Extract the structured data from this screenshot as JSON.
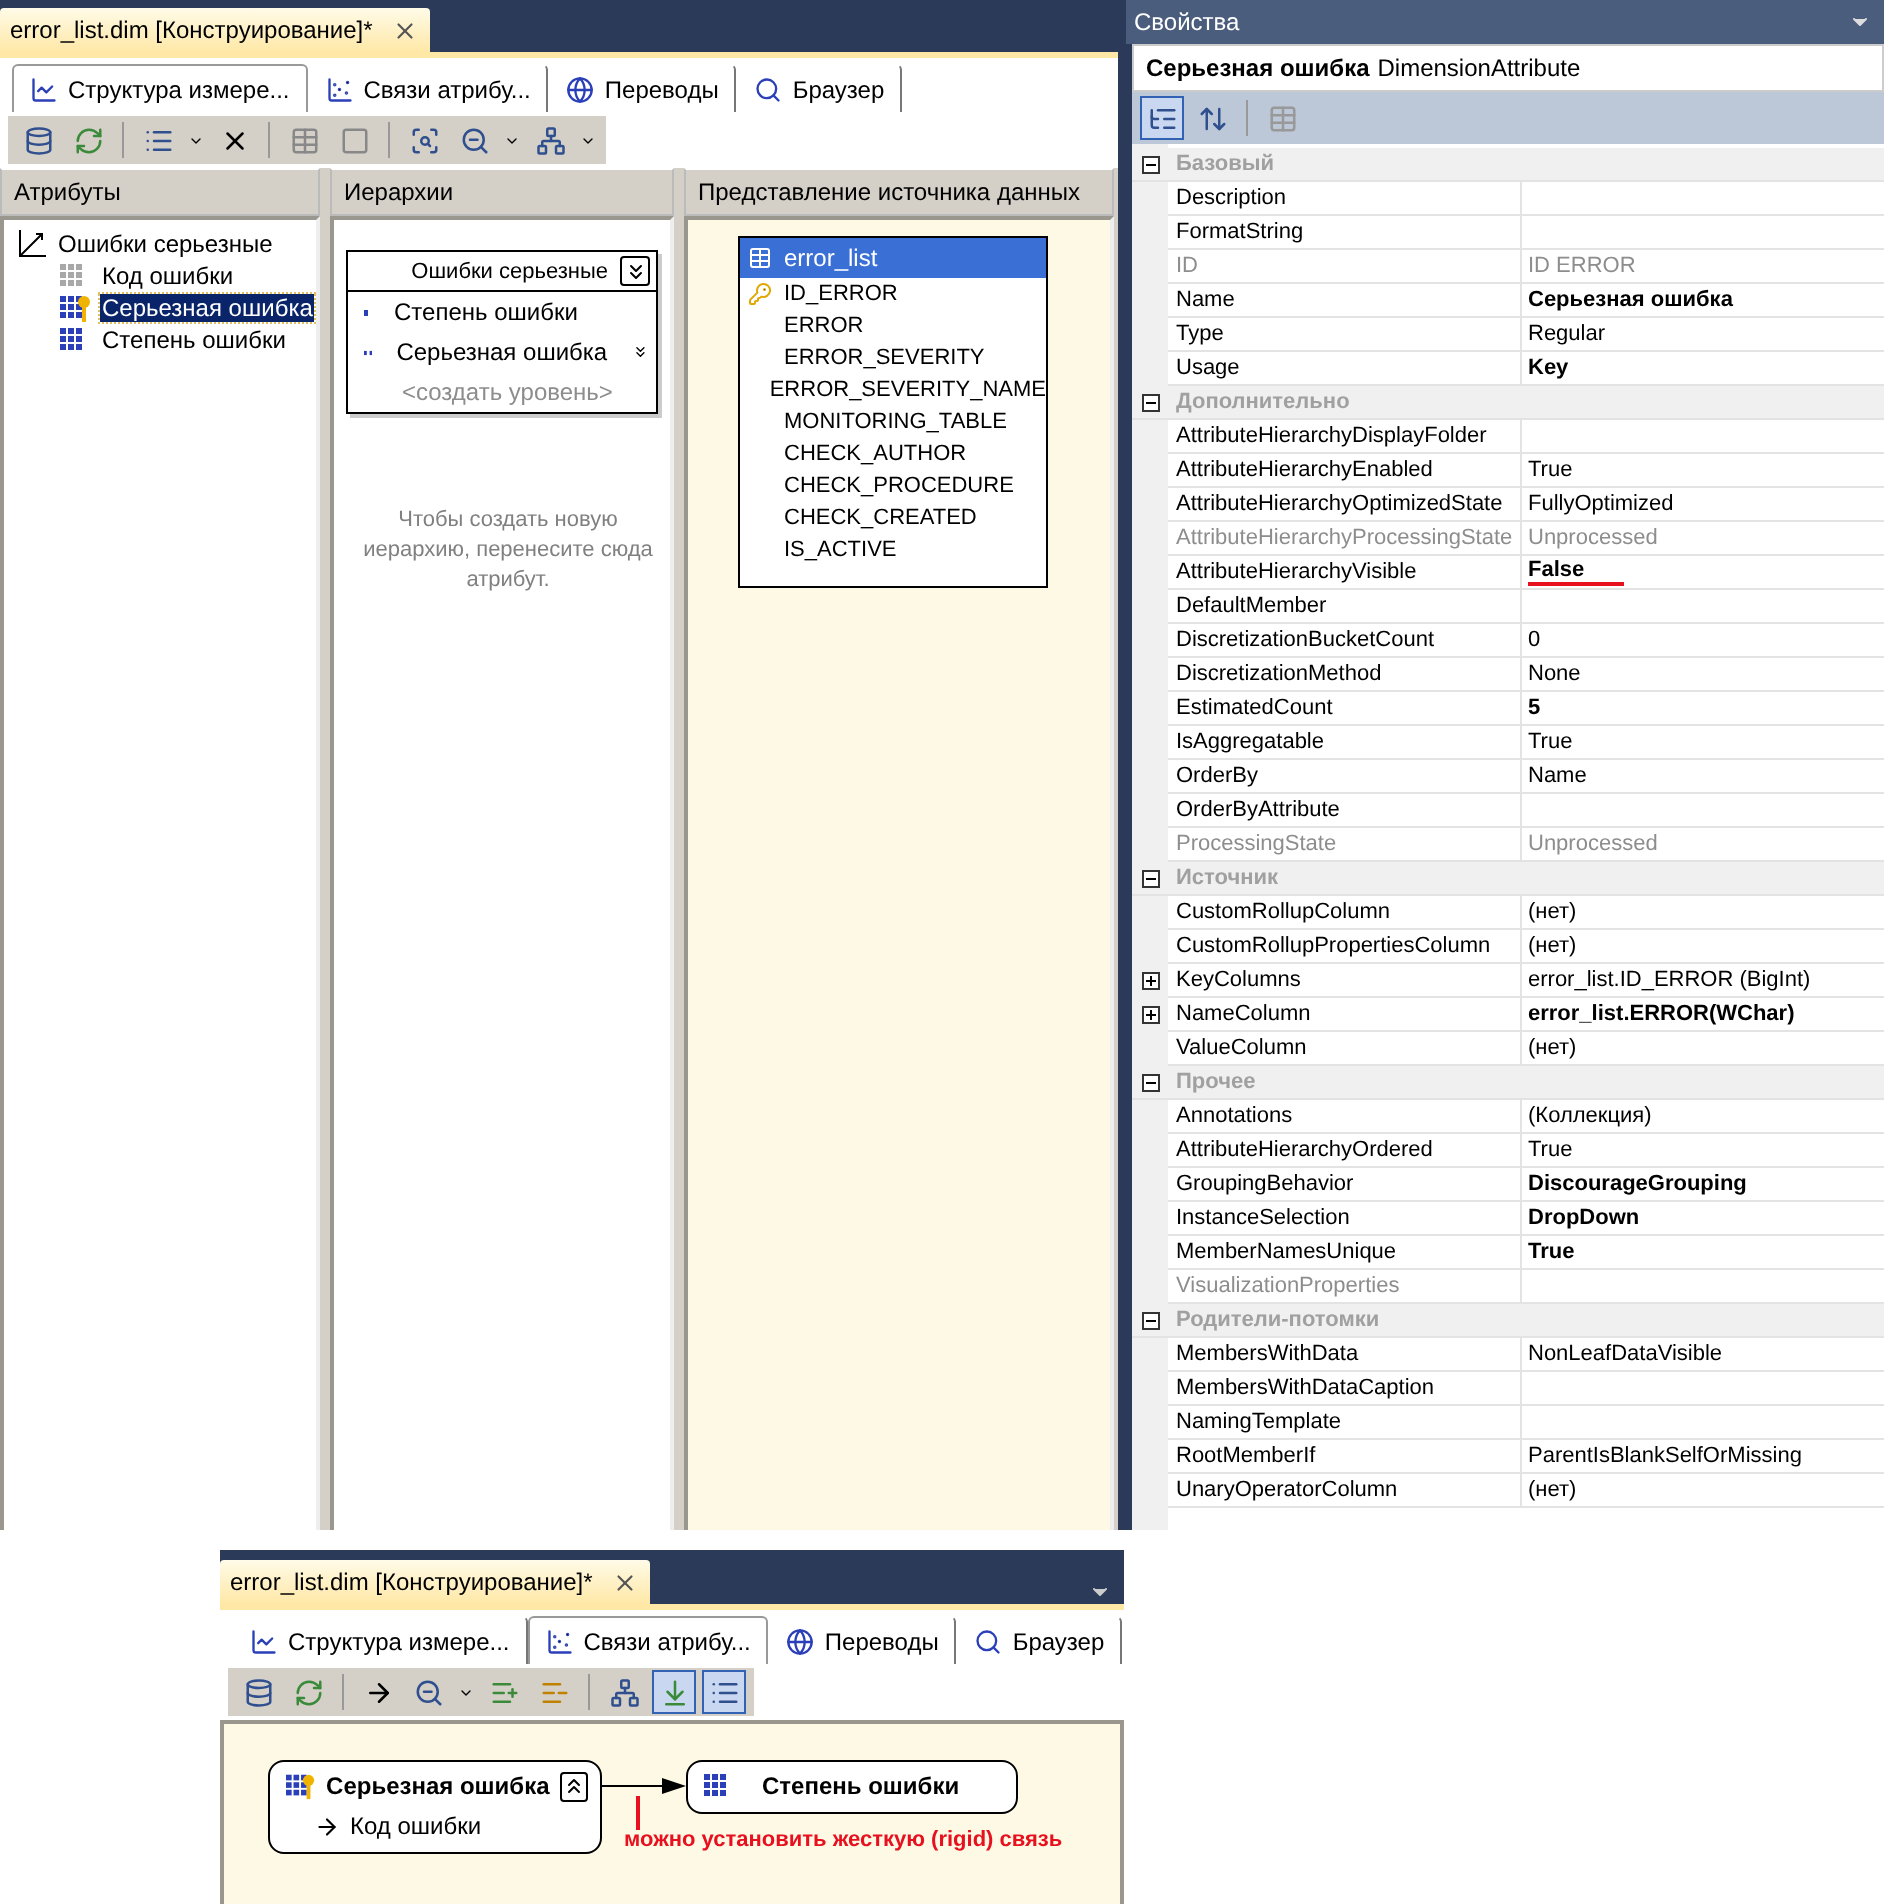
{
  "main_window": {
    "document_tab": {
      "title": "error_list.dim [Конструирование]*"
    },
    "designer_tabs": [
      {
        "label": "Структура измере...",
        "selected": true
      },
      {
        "label": "Связи атрибу...",
        "selected": false
      },
      {
        "label": "Переводы",
        "selected": false
      },
      {
        "label": "Браузер",
        "selected": false
      }
    ],
    "attributes_pane": {
      "title": "Атрибуты",
      "dimension": "Ошибки серьезные",
      "items": [
        {
          "label": "Код ошибки",
          "kind": "inactive",
          "selected": false
        },
        {
          "label": "Серьезная ошибка",
          "kind": "key",
          "selected": true
        },
        {
          "label": "Степень ошибки",
          "kind": "attribute",
          "selected": false
        }
      ]
    },
    "hierarchies_pane": {
      "title": "Иерархии",
      "hierarchy": {
        "name": "Ошибки серьезные",
        "levels": [
          "Степень ошибки",
          "Серьезная ошибка"
        ],
        "placeholder": "<создать уровень>"
      },
      "hint": "Чтобы создать новую иерархию, перенесите сюда атрибут."
    },
    "dsv_pane": {
      "title": "Представление источника данных",
      "table": {
        "name": "error_list",
        "columns": [
          {
            "name": "ID_ERROR",
            "key": true
          },
          {
            "name": "ERROR",
            "key": false
          },
          {
            "name": "ERROR_SEVERITY",
            "key": false
          },
          {
            "name": "ERROR_SEVERITY_NAME",
            "key": false
          },
          {
            "name": "MONITORING_TABLE",
            "key": false
          },
          {
            "name": "CHECK_AUTHOR",
            "key": false
          },
          {
            "name": "CHECK_PROCEDURE",
            "key": false
          },
          {
            "name": "CHECK_CREATED",
            "key": false
          },
          {
            "name": "IS_ACTIVE",
            "key": false
          }
        ]
      }
    }
  },
  "properties": {
    "title": "Свойства",
    "object_name": "Серьезная ошибка",
    "object_type": "DimensionAttribute",
    "categories": [
      {
        "name": "Базовый",
        "expanded": true,
        "rows": [
          {
            "name": "Description",
            "disabled": false
          },
          {
            "name": "FormatString",
            "disabled": false
          },
          {
            "name": "ID",
            "value": "ID ERROR",
            "disabled": true
          },
          {
            "name": "Name",
            "value": "Серьезная ошибка",
            "bold": true,
            "disabled": false
          },
          {
            "name": "Type",
            "value": "Regular",
            "disabled": false
          },
          {
            "name": "Usage",
            "value": "Key",
            "bold": true,
            "disabled": false
          }
        ]
      },
      {
        "name": "Дополнительно",
        "expanded": true,
        "rows": [
          {
            "name": "AttributeHierarchyDisplayFolder",
            "disabled": false
          },
          {
            "name": "AttributeHierarchyEnabled",
            "value": "True",
            "disabled": false
          },
          {
            "name": "AttributeHierarchyOptimizedState",
            "value": "FullyOptimized",
            "disabled": false
          },
          {
            "name": "AttributeHierarchyProcessingState",
            "value": "Unprocessed",
            "disabled": true
          },
          {
            "name": "AttributeHierarchyVisible",
            "value": "False",
            "bold": true,
            "disabled": false,
            "underlined": true
          },
          {
            "name": "DefaultMember",
            "disabled": false
          },
          {
            "name": "DiscretizationBucketCount",
            "value": "0",
            "disabled": false
          },
          {
            "name": "DiscretizationMethod",
            "value": "None",
            "disabled": false
          },
          {
            "name": "EstimatedCount",
            "value": "5",
            "bold": true,
            "disabled": false
          },
          {
            "name": "IsAggregatable",
            "value": "True",
            "disabled": false
          },
          {
            "name": "OrderBy",
            "value": "Name",
            "disabled": false
          },
          {
            "name": "OrderByAttribute",
            "disabled": false
          },
          {
            "name": "ProcessingState",
            "value": "Unprocessed",
            "disabled": true
          }
        ]
      },
      {
        "name": "Источник",
        "expanded": true,
        "rows": [
          {
            "name": "CustomRollupColumn",
            "value": "(нет)",
            "disabled": false
          },
          {
            "name": "CustomRollupPropertiesColumn",
            "value": "(нет)",
            "disabled": false
          },
          {
            "name": "KeyColumns",
            "value": "error_list.ID_ERROR (BigInt)",
            "disabled": false,
            "expanded": false
          },
          {
            "name": "NameColumn",
            "value": "error_list.ERROR(WChar)",
            "bold": true,
            "disabled": false,
            "expanded": false
          },
          {
            "name": "ValueColumn",
            "value": "(нет)",
            "disabled": false
          }
        ]
      },
      {
        "name": "Прочее",
        "expanded": true,
        "rows": [
          {
            "name": "Annotations",
            "value": "(Коллекция)",
            "disabled": false
          },
          {
            "name": "AttributeHierarchyOrdered",
            "value": "True",
            "disabled": false
          },
          {
            "name": "GroupingBehavior",
            "value": "DiscourageGrouping",
            "bold": true,
            "disabled": false
          },
          {
            "name": "InstanceSelection",
            "value": "DropDown",
            "bold": true,
            "disabled": false
          },
          {
            "name": "MemberNamesUnique",
            "value": "True",
            "bold": true,
            "disabled": false
          },
          {
            "name": "VisualizationProperties",
            "disabled": true
          }
        ]
      },
      {
        "name": "Родители-потомки",
        "expanded": true,
        "rows": [
          {
            "name": "MembersWithData",
            "value": "NonLeafDataVisible",
            "disabled": false
          },
          {
            "name": "MembersWithDataCaption",
            "disabled": false
          },
          {
            "name": "NamingTemplate",
            "disabled": false
          },
          {
            "name": "RootMemberIf",
            "value": "ParentIsBlankSelfOrMissing",
            "disabled": false
          },
          {
            "name": "UnaryOperatorColumn",
            "value": "(нет)",
            "disabled": false
          }
        ]
      }
    ]
  },
  "second_window": {
    "document_tab": {
      "title": "error_list.dim [Конструирование]*"
    },
    "designer_tabs": [
      {
        "label": "Структура измере...",
        "selected": false
      },
      {
        "label": "Связи атрибу...",
        "selected": true
      },
      {
        "label": "Переводы",
        "selected": false
      },
      {
        "label": "Браузер",
        "selected": false
      }
    ],
    "diagram": {
      "source": {
        "name": "Серьезная ошибка",
        "children": [
          "Код ошибки"
        ]
      },
      "target": {
        "name": "Степень ошибки"
      },
      "annotation": "можно установить жесткую (rigid) связь"
    }
  }
}
